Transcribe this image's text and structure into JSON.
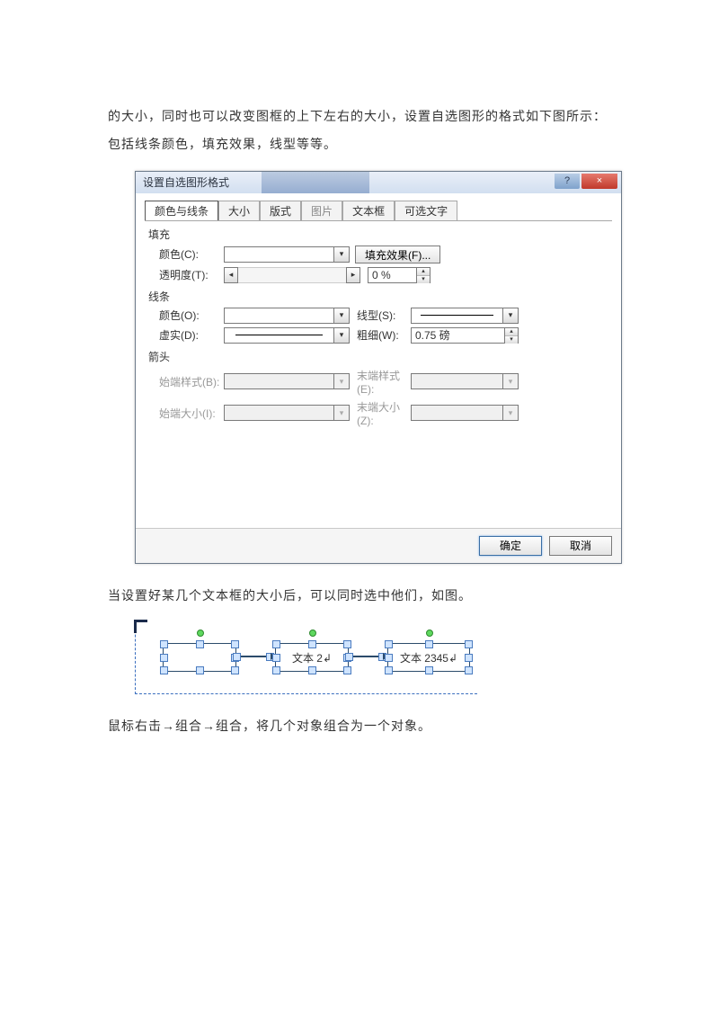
{
  "intro_para": "的大小，同时也可以改变图框的上下左右的大小，设置自选图形的格式如下图所示：包括线条颜色，填充效果，线型等等。",
  "dialog": {
    "title": "设置自选图形格式",
    "help_btn": "?",
    "close_btn": "×",
    "tabs": [
      "颜色与线条",
      "大小",
      "版式",
      "图片",
      "文本框",
      "可选文字"
    ],
    "active_tab_index": 0,
    "disabled_tab_index": 3,
    "fill": {
      "section": "填充",
      "color_label": "颜色(C):",
      "fill_effect_btn": "填充效果(F)...",
      "transparency_label": "透明度(T):",
      "transparency_value": "0 %"
    },
    "line": {
      "section": "线条",
      "color_label": "颜色(O):",
      "style_label": "线型(S):",
      "dash_label": "虚实(D):",
      "weight_label": "粗细(W):",
      "weight_value": "0.75 磅"
    },
    "arrow": {
      "section": "箭头",
      "begin_style_label": "始端样式(B):",
      "end_style_label": "末端样式(E):",
      "begin_size_label": "始端大小(I):",
      "end_size_label": "末端大小(Z):"
    },
    "ok": "确定",
    "cancel": "取消"
  },
  "mid_para": "当设置好某几个文本框的大小后，可以同时选中他们，如图。",
  "textboxes": {
    "box2": "文本 2",
    "box3": "文本 2345"
  },
  "end_para": "鼠标右击→组合→组合，将几个对象组合为一个对象。"
}
